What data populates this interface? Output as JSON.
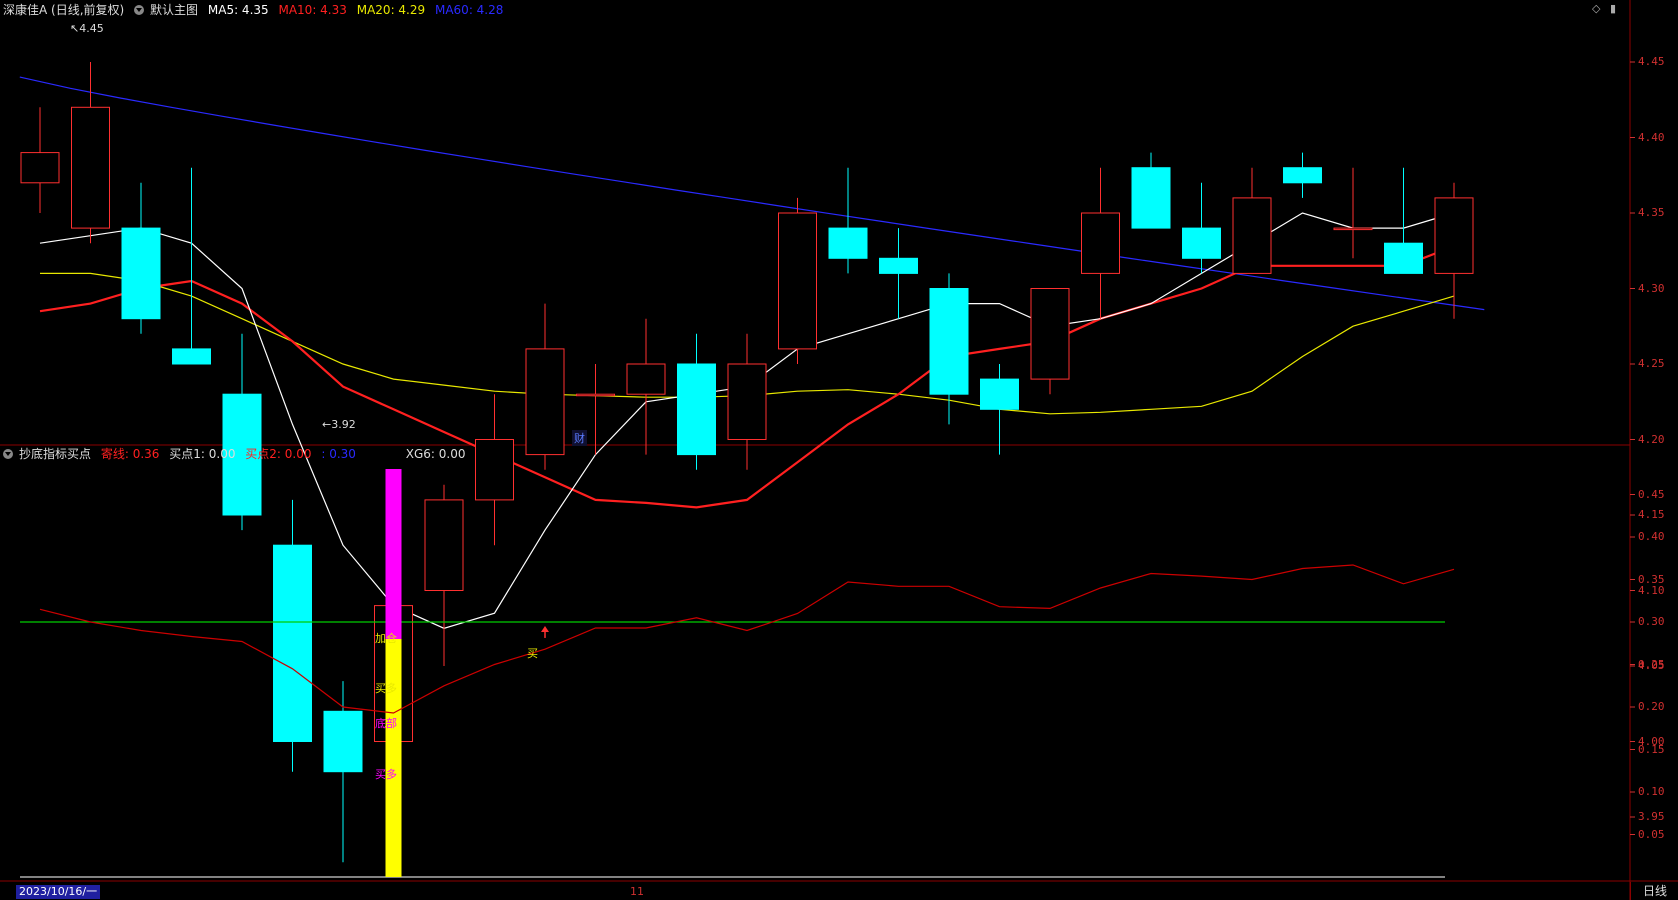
{
  "main_header": {
    "title": "深康佳A (日线,前复权)",
    "chart_mode": "默认主图",
    "ma5_label": "MA5: 4.35",
    "ma10_label": "MA10: 4.33",
    "ma20_label": "MA20: 4.29",
    "ma60_label": "MA60: 4.28"
  },
  "sub_header": {
    "indicator_name": "抄底指标买点",
    "line1_label": "寄线: 0.36",
    "buy1_label": "买点1: 0.00",
    "buy2_label": "买点2: 0.00",
    "line3_label": ": 0.30",
    "xg6_label": "XG6: 0.00"
  },
  "annotations": {
    "high_label": "4.45",
    "low_label": "3.92",
    "cai": "财",
    "jiacang": "加仓",
    "maiduo1": "买多",
    "dibu": "底部",
    "maiduo2": "买多",
    "mai": "买"
  },
  "footer": {
    "date": "2023/10/16/一",
    "tick_11": "11",
    "period": "日线"
  },
  "colors": {
    "up": "#ff3030",
    "down": "#00ffff",
    "ma5": "#ffffff",
    "ma10": "#ff2020",
    "ma20": "#e8e800",
    "ma60": "#2a2aff",
    "axis": "#d03030",
    "indicator_line": "#cc0000",
    "ref_line": "#00cc00"
  },
  "main_axis": {
    "ticks": [
      "4.45",
      "4.40",
      "4.35",
      "4.30",
      "4.25",
      "4.20",
      "4.15",
      "4.10",
      "4.05",
      "4.00",
      "3.95"
    ]
  },
  "sub_axis": {
    "ticks": [
      "0.45",
      "0.40",
      "0.35",
      "0.30",
      "0.25",
      "0.20",
      "0.15",
      "0.10",
      "0.05"
    ]
  },
  "chart_data": {
    "type": "candlestick",
    "candles": [
      {
        "o": 4.37,
        "h": 4.42,
        "l": 4.35,
        "c": 4.39
      },
      {
        "o": 4.34,
        "h": 4.45,
        "l": 4.33,
        "c": 4.42
      },
      {
        "o": 4.34,
        "h": 4.37,
        "l": 4.27,
        "c": 4.28
      },
      {
        "o": 4.26,
        "h": 4.38,
        "l": 4.25,
        "c": 4.25
      },
      {
        "o": 4.23,
        "h": 4.27,
        "l": 4.14,
        "c": 4.15
      },
      {
        "o": 4.13,
        "h": 4.16,
        "l": 3.98,
        "c": 4.0
      },
      {
        "o": 4.02,
        "h": 4.04,
        "l": 3.92,
        "c": 3.98
      },
      {
        "o": 4.0,
        "h": 4.12,
        "l": 3.96,
        "c": 4.09
      },
      {
        "o": 4.1,
        "h": 4.17,
        "l": 4.05,
        "c": 4.16
      },
      {
        "o": 4.16,
        "h": 4.23,
        "l": 4.13,
        "c": 4.2
      },
      {
        "o": 4.19,
        "h": 4.29,
        "l": 4.18,
        "c": 4.26
      },
      {
        "o": 4.23,
        "h": 4.25,
        "l": 4.19,
        "c": 4.23
      },
      {
        "o": 4.23,
        "h": 4.28,
        "l": 4.19,
        "c": 4.25
      },
      {
        "o": 4.25,
        "h": 4.27,
        "l": 4.18,
        "c": 4.19
      },
      {
        "o": 4.2,
        "h": 4.27,
        "l": 4.18,
        "c": 4.25
      },
      {
        "o": 4.26,
        "h": 4.36,
        "l": 4.25,
        "c": 4.35
      },
      {
        "o": 4.34,
        "h": 4.38,
        "l": 4.31,
        "c": 4.32
      },
      {
        "o": 4.32,
        "h": 4.34,
        "l": 4.28,
        "c": 4.31
      },
      {
        "o": 4.3,
        "h": 4.31,
        "l": 4.21,
        "c": 4.23
      },
      {
        "o": 4.24,
        "h": 4.25,
        "l": 4.19,
        "c": 4.22
      },
      {
        "o": 4.24,
        "h": 4.3,
        "l": 4.23,
        "c": 4.3
      },
      {
        "o": 4.31,
        "h": 4.38,
        "l": 4.28,
        "c": 4.35
      },
      {
        "o": 4.38,
        "h": 4.39,
        "l": 4.34,
        "c": 4.34
      },
      {
        "o": 4.34,
        "h": 4.37,
        "l": 4.31,
        "c": 4.32
      },
      {
        "o": 4.31,
        "h": 4.38,
        "l": 4.31,
        "c": 4.36
      },
      {
        "o": 4.38,
        "h": 4.39,
        "l": 4.36,
        "c": 4.37
      },
      {
        "o": 4.34,
        "h": 4.38,
        "l": 4.32,
        "c": 4.34
      },
      {
        "o": 4.33,
        "h": 4.38,
        "l": 4.31,
        "c": 4.31
      },
      {
        "o": 4.31,
        "h": 4.37,
        "l": 4.28,
        "c": 4.36
      }
    ],
    "ma5": [
      4.33,
      4.335,
      4.34,
      4.33,
      4.3,
      4.21,
      4.13,
      4.09,
      4.075,
      4.085,
      4.14,
      4.19,
      4.225,
      4.23,
      4.235,
      4.26,
      4.27,
      4.28,
      4.29,
      4.29,
      4.275,
      4.28,
      4.29,
      4.31,
      4.33,
      4.35,
      4.34,
      4.34,
      4.35
    ],
    "ma10": [
      4.285,
      4.29,
      4.3,
      4.305,
      4.29,
      4.265,
      4.235,
      4.22,
      4.205,
      4.19,
      4.175,
      4.16,
      4.158,
      4.155,
      4.16,
      4.185,
      4.21,
      4.23,
      4.255,
      4.26,
      4.265,
      4.28,
      4.29,
      4.3,
      4.315,
      4.315,
      4.315,
      4.315,
      4.328
    ],
    "ma20": [
      4.31,
      4.31,
      4.305,
      4.295,
      4.28,
      4.265,
      4.25,
      4.24,
      4.236,
      4.232,
      4.23,
      4.229,
      4.228,
      4.228,
      4.229,
      4.232,
      4.233,
      4.23,
      4.226,
      4.22,
      4.217,
      4.218,
      4.22,
      4.222,
      4.232,
      4.255,
      4.275,
      4.285,
      4.295
    ],
    "ma60": {
      "start": 4.44,
      "end": 4.286
    },
    "indicator": [
      0.315,
      0.3,
      0.29,
      0.283,
      0.277,
      0.245,
      0.2,
      0.193,
      0.225,
      0.25,
      0.268,
      0.293,
      0.293,
      0.305,
      0.29,
      0.31,
      0.347,
      0.342,
      0.342,
      0.318,
      0.316,
      0.34,
      0.357,
      0.354,
      0.35,
      0.363,
      0.367,
      0.345,
      0.362
    ],
    "reference_level": 0.3,
    "signal_bar": {
      "index": 7,
      "yellow_top": 0.28,
      "magenta_top": 0.48,
      "base": 0.0
    },
    "buy_arrow": {
      "index": 10,
      "value": 0.293
    }
  }
}
